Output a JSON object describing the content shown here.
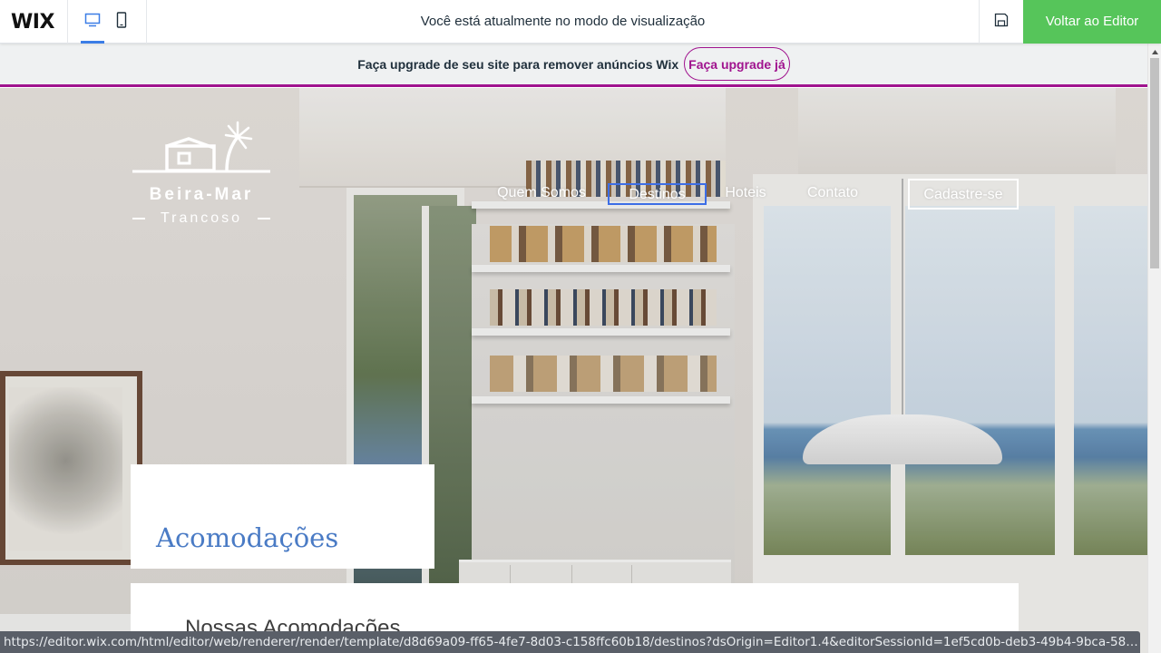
{
  "topbar": {
    "logo": "WIX",
    "preview_message": "Você está atualmente no modo de visualização",
    "back_to_editor_label": "Voltar ao Editor",
    "icons": [
      "desktop-icon",
      "mobile-icon",
      "save-icon"
    ],
    "accent_color": "#3b7de6",
    "button_color": "#56c55a"
  },
  "upgrade_banner": {
    "text": "Faça upgrade de seu site para remover anúncios Wix",
    "button_label": "Faça upgrade já",
    "accent_color": "#a0138e"
  },
  "site": {
    "logo": {
      "name": "Beira-Mar",
      "subtitle": "Trancoso",
      "icon": "house-palm-icon"
    },
    "nav": [
      {
        "label": "Quem Somos"
      },
      {
        "label": "Destinos",
        "selected": true
      },
      {
        "label": "Hoteis"
      },
      {
        "label": "Contato"
      },
      {
        "label": "Cadastre-se"
      }
    ],
    "page_heading": "Acomodações",
    "section_heading": "Nossas Acomodações",
    "heading_color": "#4a7bc5"
  },
  "status_url": "https://editor.wix.com/html/editor/web/renderer/render/template/d8d69a09-ff65-4fe7-8d03-c158ffc60b18/destinos?dsOrigin=Editor1.4&editorSessionId=1ef5cd0b-deb3-49b4-9bca-5833..."
}
